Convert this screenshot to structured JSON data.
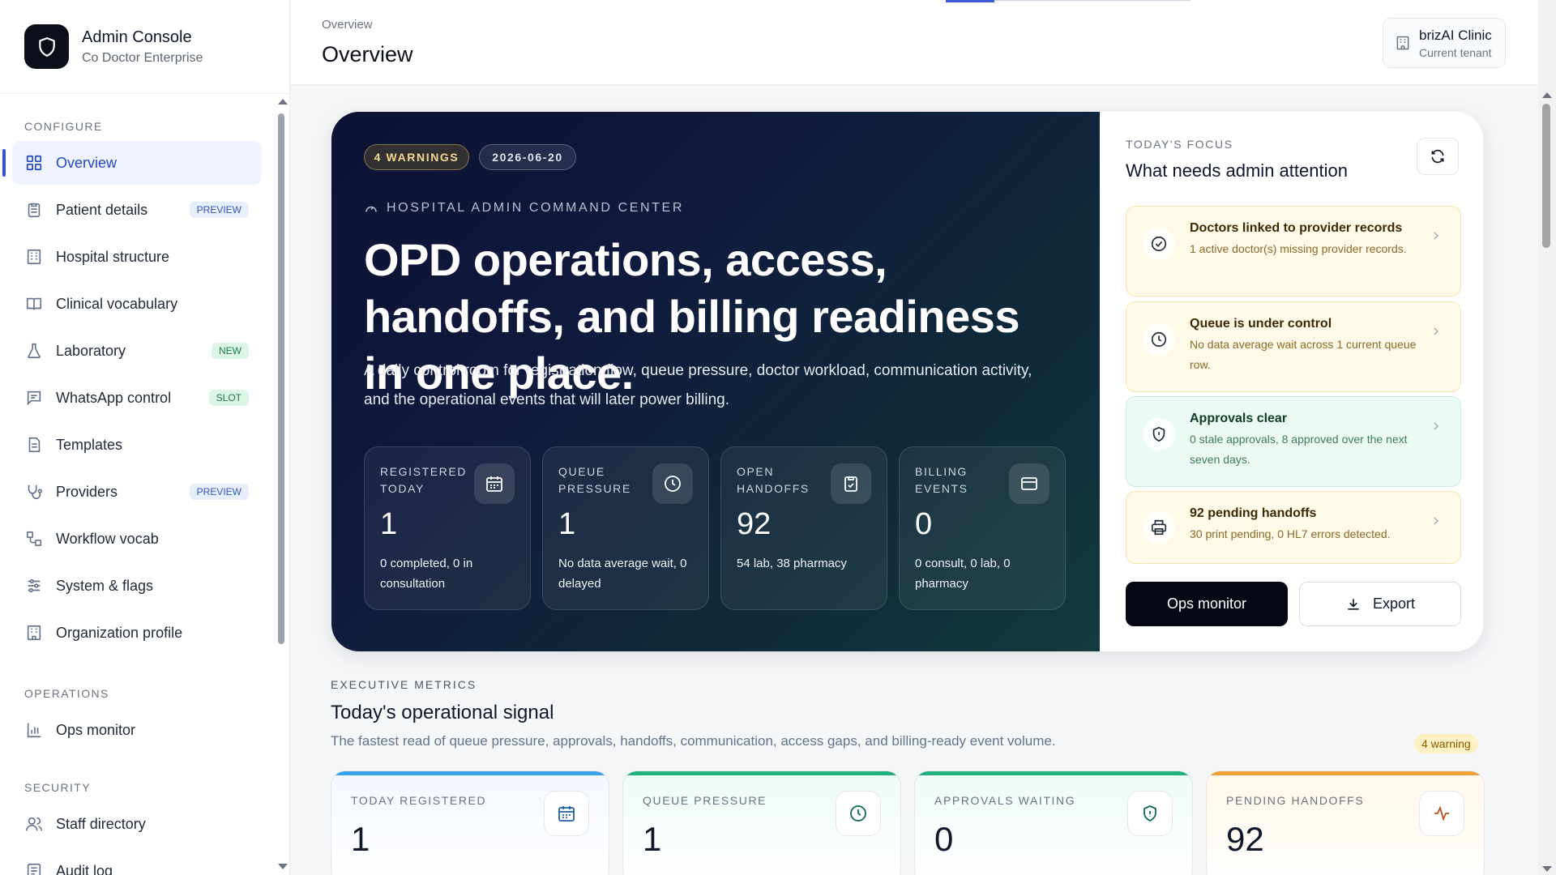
{
  "app": {
    "title": "Admin Console",
    "subtitle": "Co Doctor Enterprise"
  },
  "sidebar": {
    "sections": [
      {
        "label": "CONFIGURE"
      },
      {
        "label": "OPERATIONS"
      },
      {
        "label": "SECURITY"
      }
    ],
    "items": [
      {
        "label": "Overview",
        "icon": "grid-icon",
        "active": true
      },
      {
        "label": "Patient details",
        "icon": "clipboard-icon",
        "badge": "PREVIEW"
      },
      {
        "label": "Hospital structure",
        "icon": "building-icon"
      },
      {
        "label": "Clinical vocabulary",
        "icon": "book-icon"
      },
      {
        "label": "Laboratory",
        "icon": "flask-icon",
        "badge": "NEW"
      },
      {
        "label": "WhatsApp control",
        "icon": "message-icon",
        "badge": "SLOT"
      },
      {
        "label": "Templates",
        "icon": "document-icon"
      },
      {
        "label": "Providers",
        "icon": "stethoscope-icon",
        "badge": "PREVIEW"
      },
      {
        "label": "Workflow vocab",
        "icon": "workflow-icon"
      },
      {
        "label": "System & flags",
        "icon": "sliders-icon"
      },
      {
        "label": "Organization profile",
        "icon": "building-icon"
      },
      {
        "label": "Ops monitor",
        "icon": "bar-chart-icon"
      },
      {
        "label": "Staff directory",
        "icon": "users-icon"
      },
      {
        "label": "Audit log",
        "icon": "list-icon"
      }
    ]
  },
  "header": {
    "breadcrumb": "Overview",
    "title": "Overview",
    "tenant": {
      "name": "brizAI Clinic",
      "caption": "Current tenant"
    }
  },
  "hero": {
    "warnings_pill": "4 WARNINGS",
    "date_pill": "2026-06-20",
    "eyebrow": "HOSPITAL ADMIN COMMAND CENTER",
    "headline": "OPD operations, access, handoffs, and billing readiness in one place.",
    "description": "A daily control room for registration flow, queue pressure, doctor workload, communication activity, and the operational events that will later power billing.",
    "stats": [
      {
        "label": "REGISTERED TODAY",
        "value": "1",
        "note": "0 completed, 0 in consultation",
        "icon": "calendar-icon"
      },
      {
        "label": "QUEUE PRESSURE",
        "value": "1",
        "note": "No data average wait, 0 delayed",
        "icon": "clock-icon"
      },
      {
        "label": "OPEN HANDOFFS",
        "value": "92",
        "note": "54 lab, 38 pharmacy",
        "icon": "clipboard-check-icon"
      },
      {
        "label": "BILLING EVENTS",
        "value": "0",
        "note": "0 consult, 0 lab, 0 pharmacy",
        "icon": "credit-card-icon"
      }
    ]
  },
  "focus": {
    "eyebrow": "TODAY'S FOCUS",
    "title": "What needs admin attention",
    "cards": [
      {
        "title": "Doctors linked to provider records",
        "body": "1 active doctor(s) missing provider records.",
        "icon": "check-circle-icon",
        "tone": "amber"
      },
      {
        "title": "Queue is under control",
        "body": "No data average wait across 1 current queue row.",
        "icon": "clock-icon",
        "tone": "amber"
      },
      {
        "title": "Approvals clear",
        "body": "0 stale approvals, 8 approved over the next seven days.",
        "icon": "shield-icon",
        "tone": "green"
      },
      {
        "title": "92 pending handoffs",
        "body": "30 print pending, 0 HL7 errors detected.",
        "icon": "printer-icon",
        "tone": "amber"
      }
    ],
    "primary_button": "Ops monitor",
    "secondary_button": "Export"
  },
  "executive": {
    "eyebrow": "EXECUTIVE METRICS",
    "title": "Today's operational signal",
    "description": "The fastest read of queue pressure, approvals, handoffs, communication, access gaps, and billing-ready event volume.",
    "warning_chip": "4 warning",
    "metrics": [
      {
        "label": "TODAY REGISTERED",
        "value": "1",
        "icon": "calendar-icon",
        "accent": "#3aa0e8"
      },
      {
        "label": "QUEUE PRESSURE",
        "value": "1",
        "icon": "clock-icon",
        "accent": "#22b07d"
      },
      {
        "label": "APPROVALS WAITING",
        "value": "0",
        "icon": "shield-icon",
        "accent": "#22b07d"
      },
      {
        "label": "PENDING HANDOFFS",
        "value": "92",
        "icon": "activity-icon",
        "accent": "#f0a23a"
      }
    ]
  },
  "colors": {
    "accent": "#2f55d4",
    "hero_dark": "#0c1233",
    "warning": "#f3d891"
  }
}
